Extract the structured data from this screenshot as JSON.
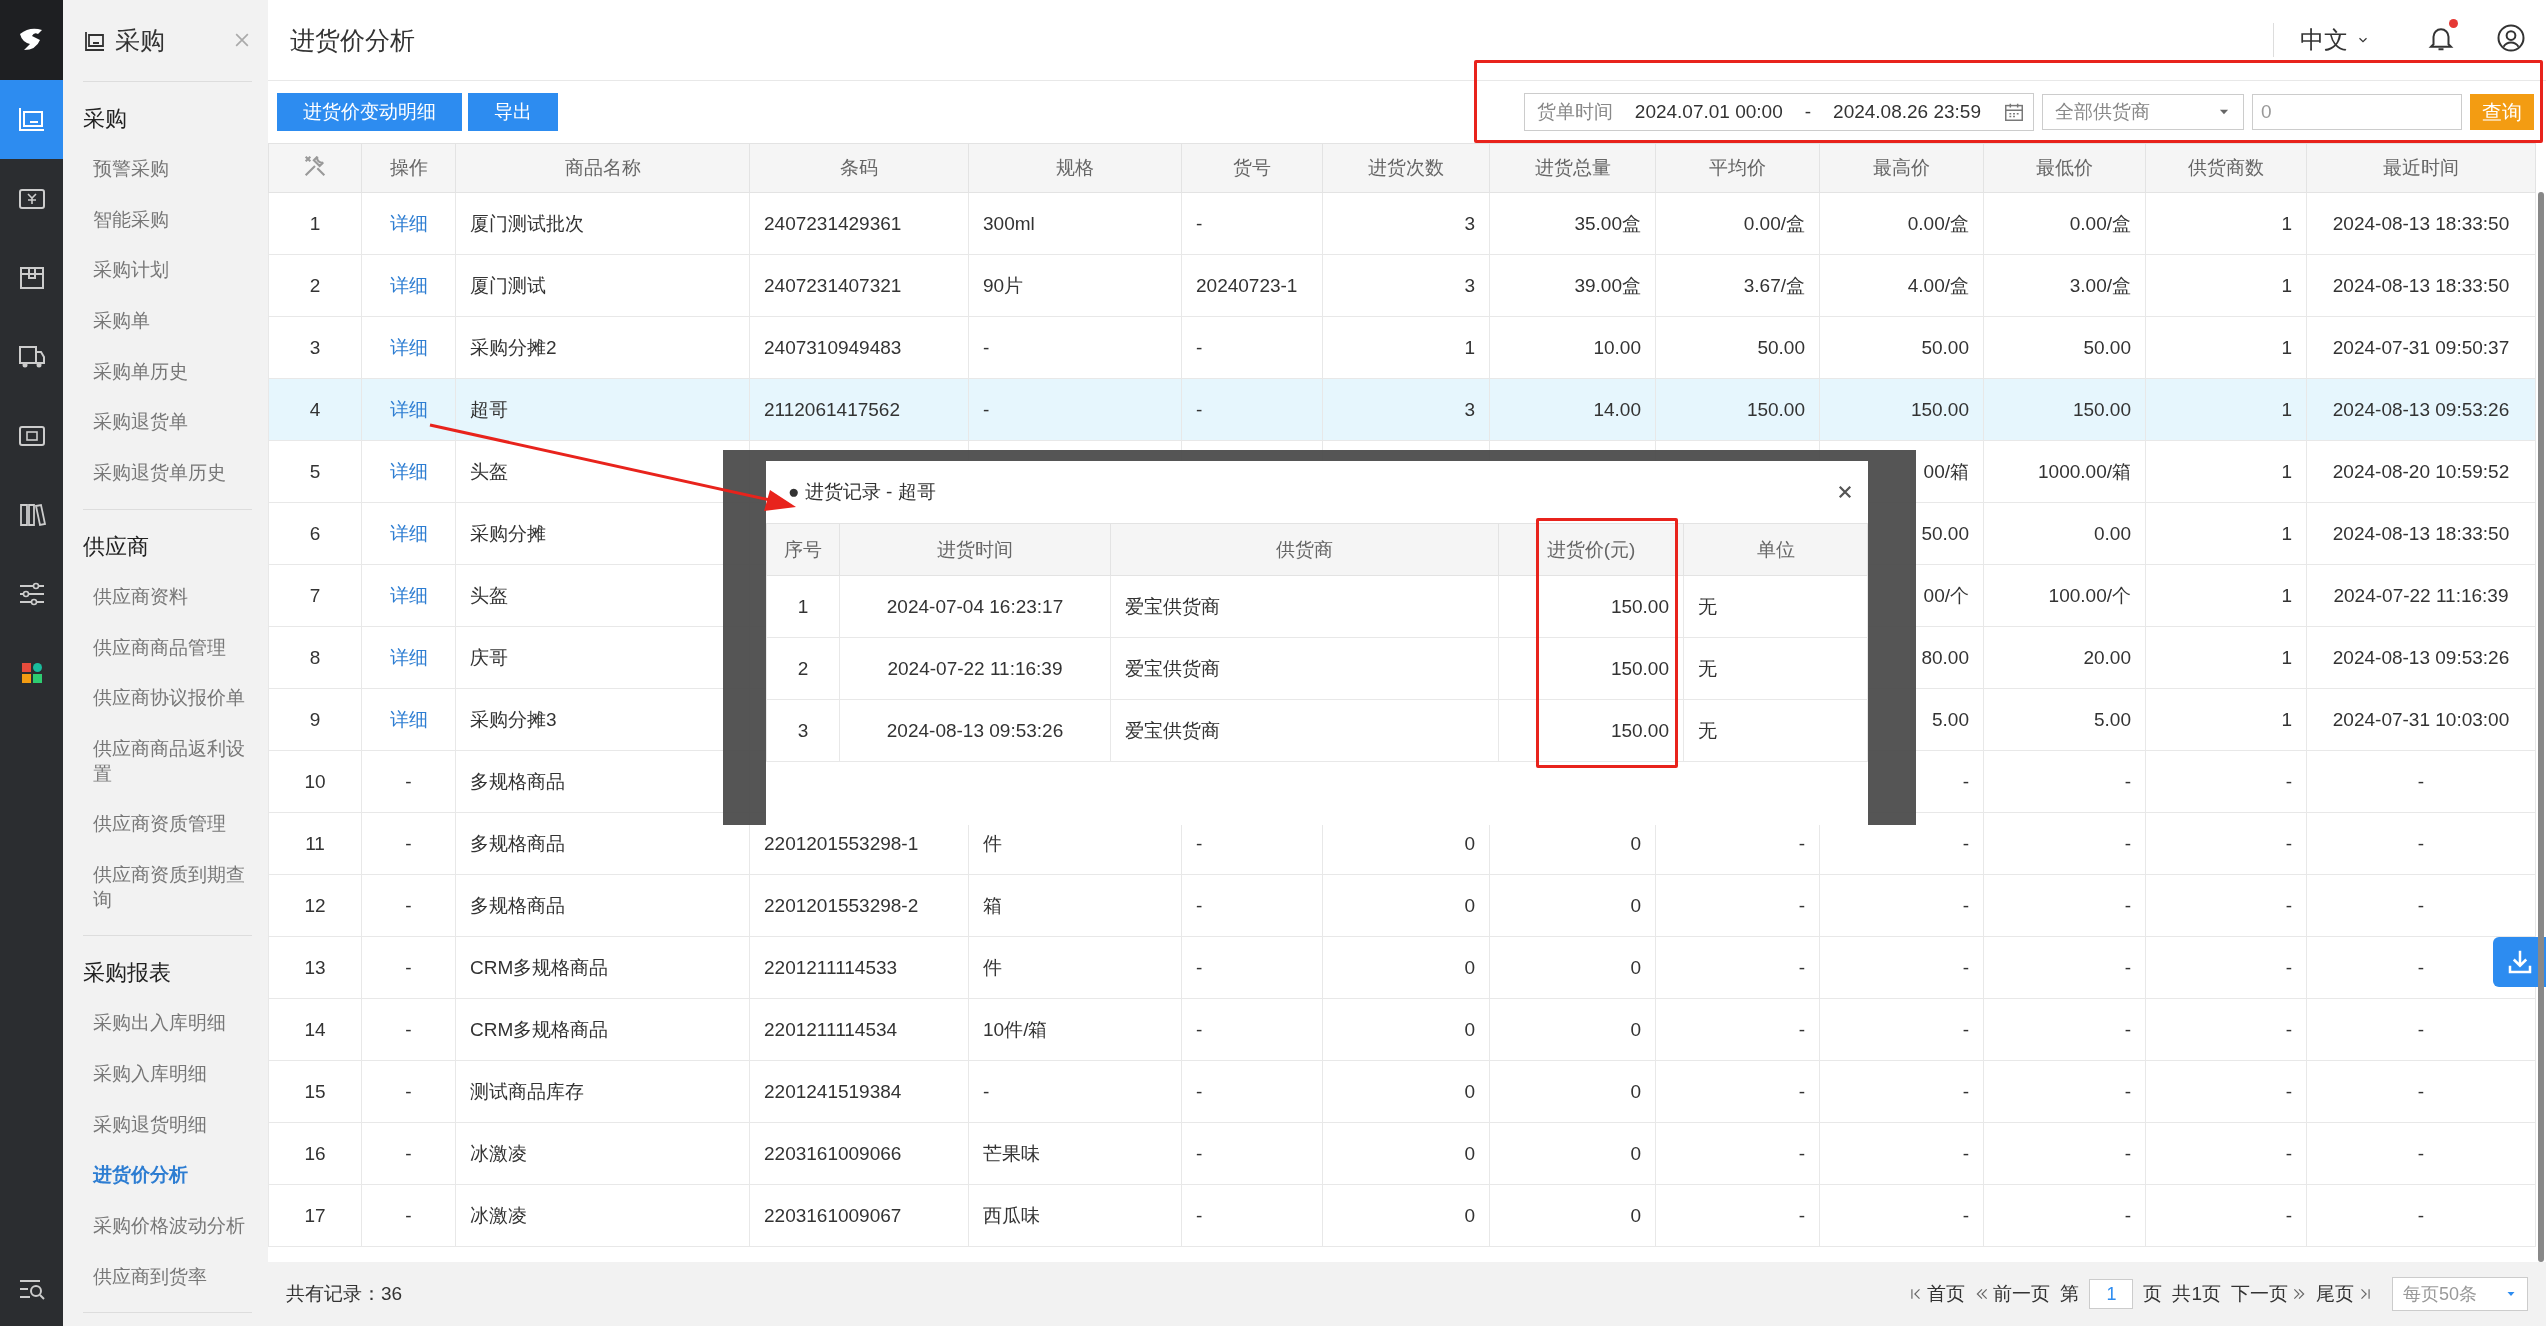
{
  "rail": [
    {
      "kind": "logo",
      "selected": false
    },
    {
      "kind": "purchase",
      "selected": true
    },
    {
      "kind": "money",
      "selected": false
    },
    {
      "kind": "box",
      "selected": false
    },
    {
      "kind": "truck",
      "selected": false
    },
    {
      "kind": "safe",
      "selected": false
    },
    {
      "kind": "books",
      "selected": false
    },
    {
      "kind": "sliders",
      "selected": false
    },
    {
      "kind": "apps",
      "selected": false
    },
    {
      "kind": "menu-search",
      "selected": false
    }
  ],
  "sidebar": {
    "title": "采购",
    "sections": [
      {
        "heading": "采购",
        "items": [
          {
            "label": "预警采购",
            "selected": false
          },
          {
            "label": "智能采购",
            "selected": false
          },
          {
            "label": "采购计划",
            "selected": false
          },
          {
            "label": "采购单",
            "selected": false
          },
          {
            "label": "采购单历史",
            "selected": false
          },
          {
            "label": "采购退货单",
            "selected": false
          },
          {
            "label": "采购退货单历史",
            "selected": false
          }
        ]
      },
      {
        "heading": "供应商",
        "items": [
          {
            "label": "供应商资料",
            "selected": false
          },
          {
            "label": "供应商商品管理",
            "selected": false
          },
          {
            "label": "供应商协议报价单",
            "selected": false
          },
          {
            "label": "供应商商品返利设置",
            "selected": false
          },
          {
            "label": "供应商资质管理",
            "selected": false
          },
          {
            "label": "供应商资质到期查询",
            "selected": false
          }
        ]
      },
      {
        "heading": "采购报表",
        "items": [
          {
            "label": "采购出入库明细",
            "selected": false
          },
          {
            "label": "采购入库明细",
            "selected": false
          },
          {
            "label": "采购退货明细",
            "selected": false
          },
          {
            "label": "进货价分析",
            "selected": true
          },
          {
            "label": "采购价格波动分析",
            "selected": false
          },
          {
            "label": "供应商到货率",
            "selected": false
          }
        ]
      }
    ]
  },
  "header": {
    "title": "进货价分析",
    "language": "中文",
    "notification_dot": true
  },
  "toolbar": {
    "buttons": [
      "进货价变动明细",
      "导出"
    ],
    "filter": {
      "date_label": "货单时间",
      "date_from": "2024.07.01 00:00",
      "separator": "-",
      "date_to": "2024.08.26 23:59",
      "supplier_placeholder": "全部供货商",
      "keyword_placeholder": "0",
      "search_button": "查询"
    }
  },
  "table": {
    "columns": [
      "",
      "操作",
      "商品名称",
      "条码",
      "规格",
      "货号",
      "进货次数",
      "进货总量",
      "平均价",
      "最高价",
      "最低价",
      "供货商数",
      "最近时间"
    ],
    "rows": [
      {
        "kind": "link",
        "selected": false,
        "cells": [
          "1",
          "详细",
          "厦门测试批次",
          "2407231429361",
          "300ml",
          "-",
          "3",
          "35.00盒",
          "0.00/盒",
          "0.00/盒",
          "0.00/盒",
          "1",
          "2024-08-13 18:33:50"
        ]
      },
      {
        "kind": "link",
        "selected": false,
        "cells": [
          "2",
          "详细",
          "厦门测试",
          "2407231407321",
          "90片",
          "20240723-1",
          "3",
          "39.00盒",
          "3.67/盒",
          "4.00/盒",
          "3.00/盒",
          "1",
          "2024-08-13 18:33:50"
        ]
      },
      {
        "kind": "link",
        "selected": false,
        "cells": [
          "3",
          "详细",
          "采购分摊2",
          "2407310949483",
          "-",
          "-",
          "1",
          "10.00",
          "50.00",
          "50.00",
          "50.00",
          "1",
          "2024-07-31 09:50:37"
        ]
      },
      {
        "kind": "link",
        "selected": true,
        "cells": [
          "4",
          "详细",
          "超哥",
          "2112061417562",
          "-",
          "-",
          "3",
          "14.00",
          "150.00",
          "150.00",
          "150.00",
          "1",
          "2024-08-13 09:53:26"
        ]
      },
      {
        "kind": "link",
        "selected": false,
        "cells": [
          "5",
          "详细",
          "头盔",
          null,
          null,
          null,
          null,
          null,
          null,
          "00/箱",
          "1000.00/箱",
          "1",
          "2024-08-20 10:59:52"
        ]
      },
      {
        "kind": "link",
        "selected": false,
        "cells": [
          "6",
          "详细",
          "采购分摊",
          null,
          null,
          null,
          null,
          null,
          null,
          "50.00",
          "0.00",
          "1",
          "2024-08-13 18:33:50"
        ]
      },
      {
        "kind": "link",
        "selected": false,
        "cells": [
          "7",
          "详细",
          "头盔",
          null,
          null,
          null,
          null,
          null,
          null,
          "00/个",
          "100.00/个",
          "1",
          "2024-07-22 11:16:39"
        ]
      },
      {
        "kind": "link",
        "selected": false,
        "cells": [
          "8",
          "详细",
          "庆哥",
          null,
          null,
          null,
          null,
          null,
          null,
          "80.00",
          "20.00",
          "1",
          "2024-08-13 09:53:26"
        ]
      },
      {
        "kind": "link",
        "selected": false,
        "cells": [
          "9",
          "详细",
          "采购分摊3",
          null,
          null,
          null,
          null,
          null,
          null,
          "5.00",
          "5.00",
          "1",
          "2024-07-31 10:03:00"
        ]
      },
      {
        "kind": "text",
        "selected": false,
        "cells": [
          "10",
          "-",
          "多规格商品",
          null,
          null,
          null,
          null,
          null,
          null,
          "-",
          "-",
          "-",
          "-"
        ]
      },
      {
        "kind": "text",
        "selected": false,
        "cells": [
          "11",
          "-",
          "多规格商品",
          "2201201553298-1",
          "件",
          "-",
          "0",
          "0",
          "-",
          "-",
          "-",
          "-",
          "-"
        ]
      },
      {
        "kind": "text",
        "selected": false,
        "cells": [
          "12",
          "-",
          "多规格商品",
          "2201201553298-2",
          "箱",
          "-",
          "0",
          "0",
          "-",
          "-",
          "-",
          "-",
          "-"
        ]
      },
      {
        "kind": "text",
        "selected": false,
        "cells": [
          "13",
          "-",
          "CRM多规格商品",
          "2201211114533",
          "件",
          "-",
          "0",
          "0",
          "-",
          "-",
          "-",
          "-",
          "-"
        ]
      },
      {
        "kind": "text",
        "selected": false,
        "cells": [
          "14",
          "-",
          "CRM多规格商品",
          "2201211114534",
          "10件/箱",
          "-",
          "0",
          "0",
          "-",
          "-",
          "-",
          "-",
          "-"
        ]
      },
      {
        "kind": "text",
        "selected": false,
        "cells": [
          "15",
          "-",
          "测试商品库存",
          "2201241519384",
          "-",
          "-",
          "0",
          "0",
          "-",
          "-",
          "-",
          "-",
          "-"
        ]
      },
      {
        "kind": "text",
        "selected": false,
        "cells": [
          "16",
          "-",
          "冰激凌",
          "2203161009066",
          "芒果味",
          "-",
          "0",
          "0",
          "-",
          "-",
          "-",
          "-",
          "-"
        ]
      },
      {
        "kind": "text",
        "selected": false,
        "cells": [
          "17",
          "-",
          "冰激凌",
          "2203161009067",
          "西瓜味",
          "-",
          "0",
          "0",
          "-",
          "-",
          "-",
          "-",
          "-"
        ]
      }
    ]
  },
  "modal": {
    "title": "● 进货记录 - 超哥",
    "columns": [
      "序号",
      "进货时间",
      "供货商",
      "进货价(元)",
      "单位"
    ],
    "rows": [
      [
        "1",
        "2024-07-04 16:23:17",
        "爱宝供货商",
        "150.00",
        "无"
      ],
      [
        "2",
        "2024-07-22 11:16:39",
        "爱宝供货商",
        "150.00",
        "无"
      ],
      [
        "3",
        "2024-08-13 09:53:26",
        "爱宝供货商",
        "150.00",
        "无"
      ]
    ]
  },
  "footer": {
    "total": "共有记录：36",
    "first": "首页",
    "prev": "前一页",
    "page_prefix": "第",
    "page": "1",
    "page_suffix": "页",
    "pages": "共1页",
    "next": "下一页",
    "last": "尾页",
    "page_size": "每页50条"
  }
}
